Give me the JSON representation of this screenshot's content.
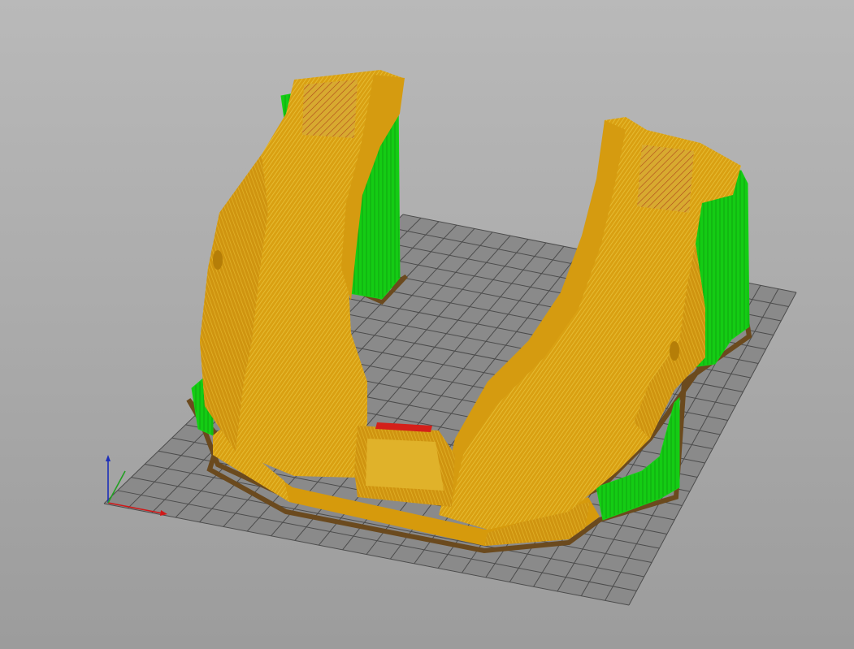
{
  "viewport": {
    "kind": "3d-print-preview",
    "background_top": "#b9b9b9",
    "background_bottom": "#9c9c9c"
  },
  "bed": {
    "surface_color": "#8a8a8a",
    "grid_color": "#4c4c4c",
    "grid_rows": 22,
    "grid_cols": 22
  },
  "axes": {
    "x_color": "#d01818",
    "y_color": "#22a022",
    "z_color": "#1c2fb8"
  },
  "model": {
    "perimeter_color": "#d69a0c",
    "infill_color": "#e6ba1e",
    "support_color": "#16d016",
    "skirt_color": "#6b4a1e",
    "bridge_color": "#d4201a"
  }
}
